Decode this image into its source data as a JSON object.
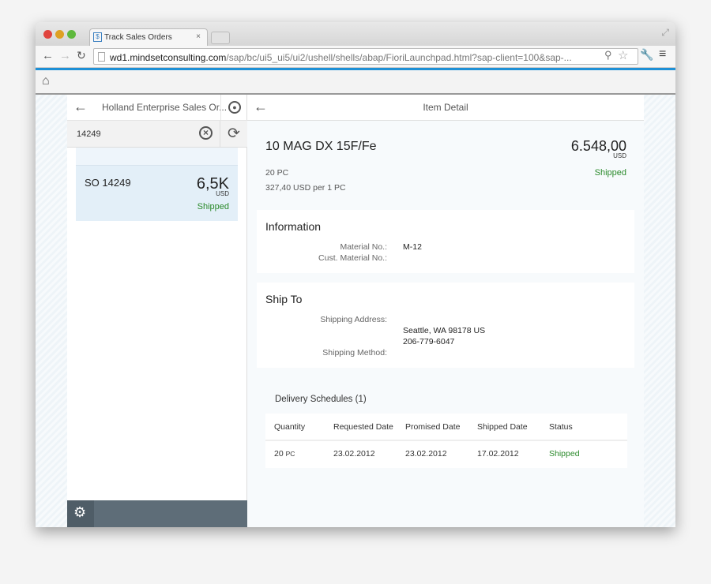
{
  "browser": {
    "tab_title": "Track Sales Orders",
    "url_host": "wd1.mindsetconsulting.com",
    "url_path": "/sap/bc/ui5_ui5/ui2/ushell/shells/abap/FioriLaunchpad.html?sap-client=100&sap-..."
  },
  "master": {
    "title": "Holland Enterprise Sales Or...",
    "search_value": "14249",
    "items": [
      {
        "id": "SO 14249",
        "amount": "6,5K",
        "currency": "USD",
        "status": "Shipped"
      }
    ]
  },
  "detail": {
    "title": "Item Detail",
    "product": "10 MAG DX 15F/Fe",
    "amount": "6.548,00",
    "currency": "USD",
    "status": "Shipped",
    "quantity": "20 PC",
    "unit_price": "327,40 USD per 1 PC",
    "information": {
      "heading": "Information",
      "material_label": "Material No.:",
      "material_value": "M-12",
      "cust_material_label": "Cust. Material No.:"
    },
    "ship_to": {
      "heading": "Ship To",
      "address_label": "Shipping Address:",
      "address_line1": "Seattle, WA 98178 US",
      "address_line2": "206-779-6047",
      "method_label": "Shipping Method:"
    },
    "schedules": {
      "heading": "Delivery Schedules (1)",
      "columns": [
        "Quantity",
        "Requested Date",
        "Promised Date",
        "Shipped Date",
        "Status"
      ],
      "rows": [
        {
          "qty": "20",
          "unit": "PC",
          "requested": "23.02.2012",
          "promised": "23.02.2012",
          "shipped": "17.02.2012",
          "status": "Shipped"
        }
      ]
    }
  },
  "colors": {
    "accent": "#1e90d6",
    "shipped": "#2b8a2b",
    "footer": "#5e6d78"
  }
}
